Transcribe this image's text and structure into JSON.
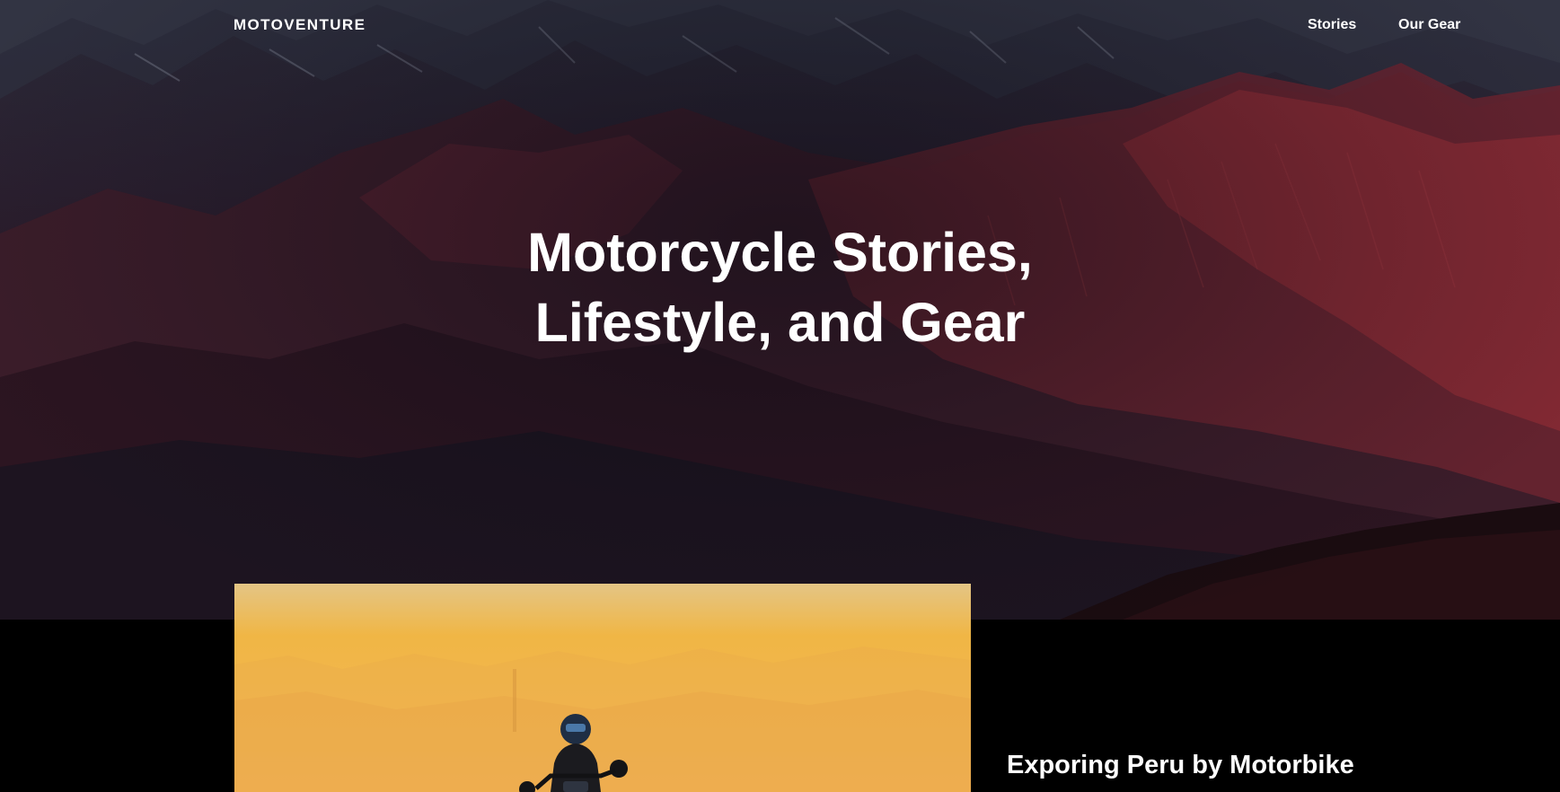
{
  "nav": {
    "brand": "MOTOVENTURE",
    "links": [
      {
        "label": "Stories"
      },
      {
        "label": "Our Gear"
      }
    ]
  },
  "hero": {
    "title_line_1": "Motorcycle Stories,",
    "title_line_2": "Lifestyle, and Gear",
    "background_image": "mountain-range-photo"
  },
  "featured_story": {
    "title": "Exporing Peru by Motorbike",
    "image": "motorcyclist-in-golden-haze-photo"
  },
  "colors": {
    "page_background": "#000000",
    "text": "#ffffff",
    "mountain_accent": "#8a2a34",
    "sunset_accent": "#f5b44a"
  }
}
